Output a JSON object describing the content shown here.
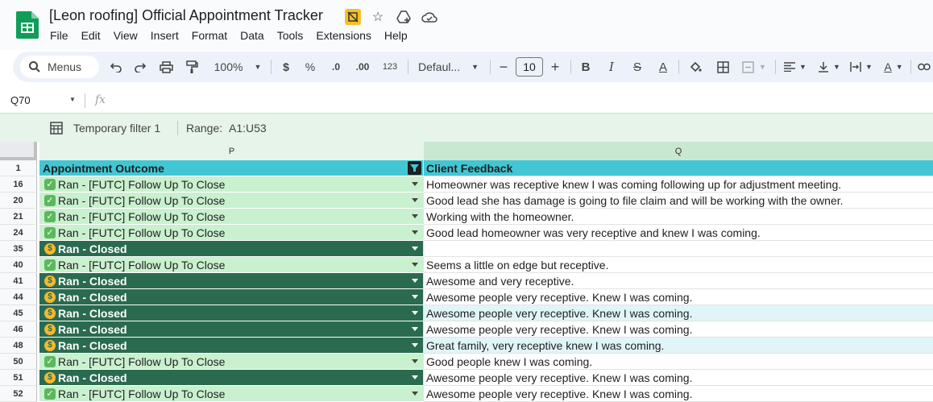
{
  "doc": {
    "title": "[Leon roofing] Official Appointment Tracker"
  },
  "menu": [
    "File",
    "Edit",
    "View",
    "Insert",
    "Format",
    "Data",
    "Tools",
    "Extensions",
    "Help"
  ],
  "toolbar": {
    "search_label": "Menus",
    "zoom": "100%",
    "currency": "$",
    "percent": "%",
    "dec_decrease": ".0",
    "dec_increase": ".00",
    "number_format": "123",
    "font": "Defaul...",
    "font_size": "10",
    "minus": "−",
    "plus": "+",
    "bold": "B",
    "italic": "I",
    "strike": "S",
    "text_color": "A"
  },
  "formula": {
    "name_box": "Q70",
    "fx": "fx"
  },
  "filter_bar": {
    "label": "Temporary filter 1",
    "range_label": "Range:",
    "range": "A1:U53"
  },
  "columns": {
    "p": "P",
    "q": "Q"
  },
  "header": {
    "row": "1",
    "p": "Appointment Outcome",
    "q": "Client Feedback"
  },
  "colors": {
    "header_cyan": "#43c6d4",
    "closed_dark": "#2a6b50",
    "followup_light": "#c9f0cf",
    "highlight_q": "#e1f5f8"
  },
  "rows": [
    {
      "row": "16",
      "outcome": "Ran - [FUTC] Follow Up To Close",
      "type": "followup",
      "feedback": "Homeowner was receptive knew I was coming following up for adjustment meeting.",
      "hl": false
    },
    {
      "row": "20",
      "outcome": "Ran - [FUTC] Follow Up To Close",
      "type": "followup",
      "feedback": "Good lead she has damage is going to file claim and will be working with the owner.",
      "hl": false
    },
    {
      "row": "21",
      "outcome": "Ran - [FUTC] Follow Up To Close",
      "type": "followup",
      "feedback": "Working with the homeowner.",
      "hl": false
    },
    {
      "row": "24",
      "outcome": "Ran - [FUTC] Follow Up To Close",
      "type": "followup",
      "feedback": "Good lead homeowner was very receptive and knew I was coming.",
      "hl": false
    },
    {
      "row": "35",
      "outcome": "Ran - Closed",
      "type": "closed",
      "feedback": "",
      "hl": false
    },
    {
      "row": "40",
      "outcome": "Ran - [FUTC] Follow Up To Close",
      "type": "followup",
      "feedback": "Seems a little on edge but receptive.",
      "hl": false
    },
    {
      "row": "41",
      "outcome": "Ran - Closed",
      "type": "closed",
      "feedback": "Awesome and very receptive.",
      "hl": false
    },
    {
      "row": "44",
      "outcome": "Ran - Closed",
      "type": "closed",
      "feedback": "Awesome people very receptive. Knew I was coming.",
      "hl": false
    },
    {
      "row": "45",
      "outcome": "Ran - Closed",
      "type": "closed",
      "feedback": "Awesome people very receptive. Knew I was coming.",
      "hl": true
    },
    {
      "row": "46",
      "outcome": "Ran - Closed",
      "type": "closed",
      "feedback": "Awesome people very receptive. Knew I was coming.",
      "hl": false
    },
    {
      "row": "48",
      "outcome": "Ran - Closed",
      "type": "closed",
      "feedback": "Great family, very receptive knew I was coming.",
      "hl": true
    },
    {
      "row": "50",
      "outcome": "Ran - [FUTC] Follow Up To Close",
      "type": "followup",
      "feedback": "Good people knew I was coming.",
      "hl": false
    },
    {
      "row": "51",
      "outcome": "Ran - Closed",
      "type": "closed",
      "feedback": "Awesome people very receptive. Knew I was coming.",
      "hl": false
    },
    {
      "row": "52",
      "outcome": "Ran - [FUTC] Follow Up To Close",
      "type": "followup",
      "feedback": "Awesome people very receptive. Knew I was coming.",
      "hl": false
    }
  ]
}
